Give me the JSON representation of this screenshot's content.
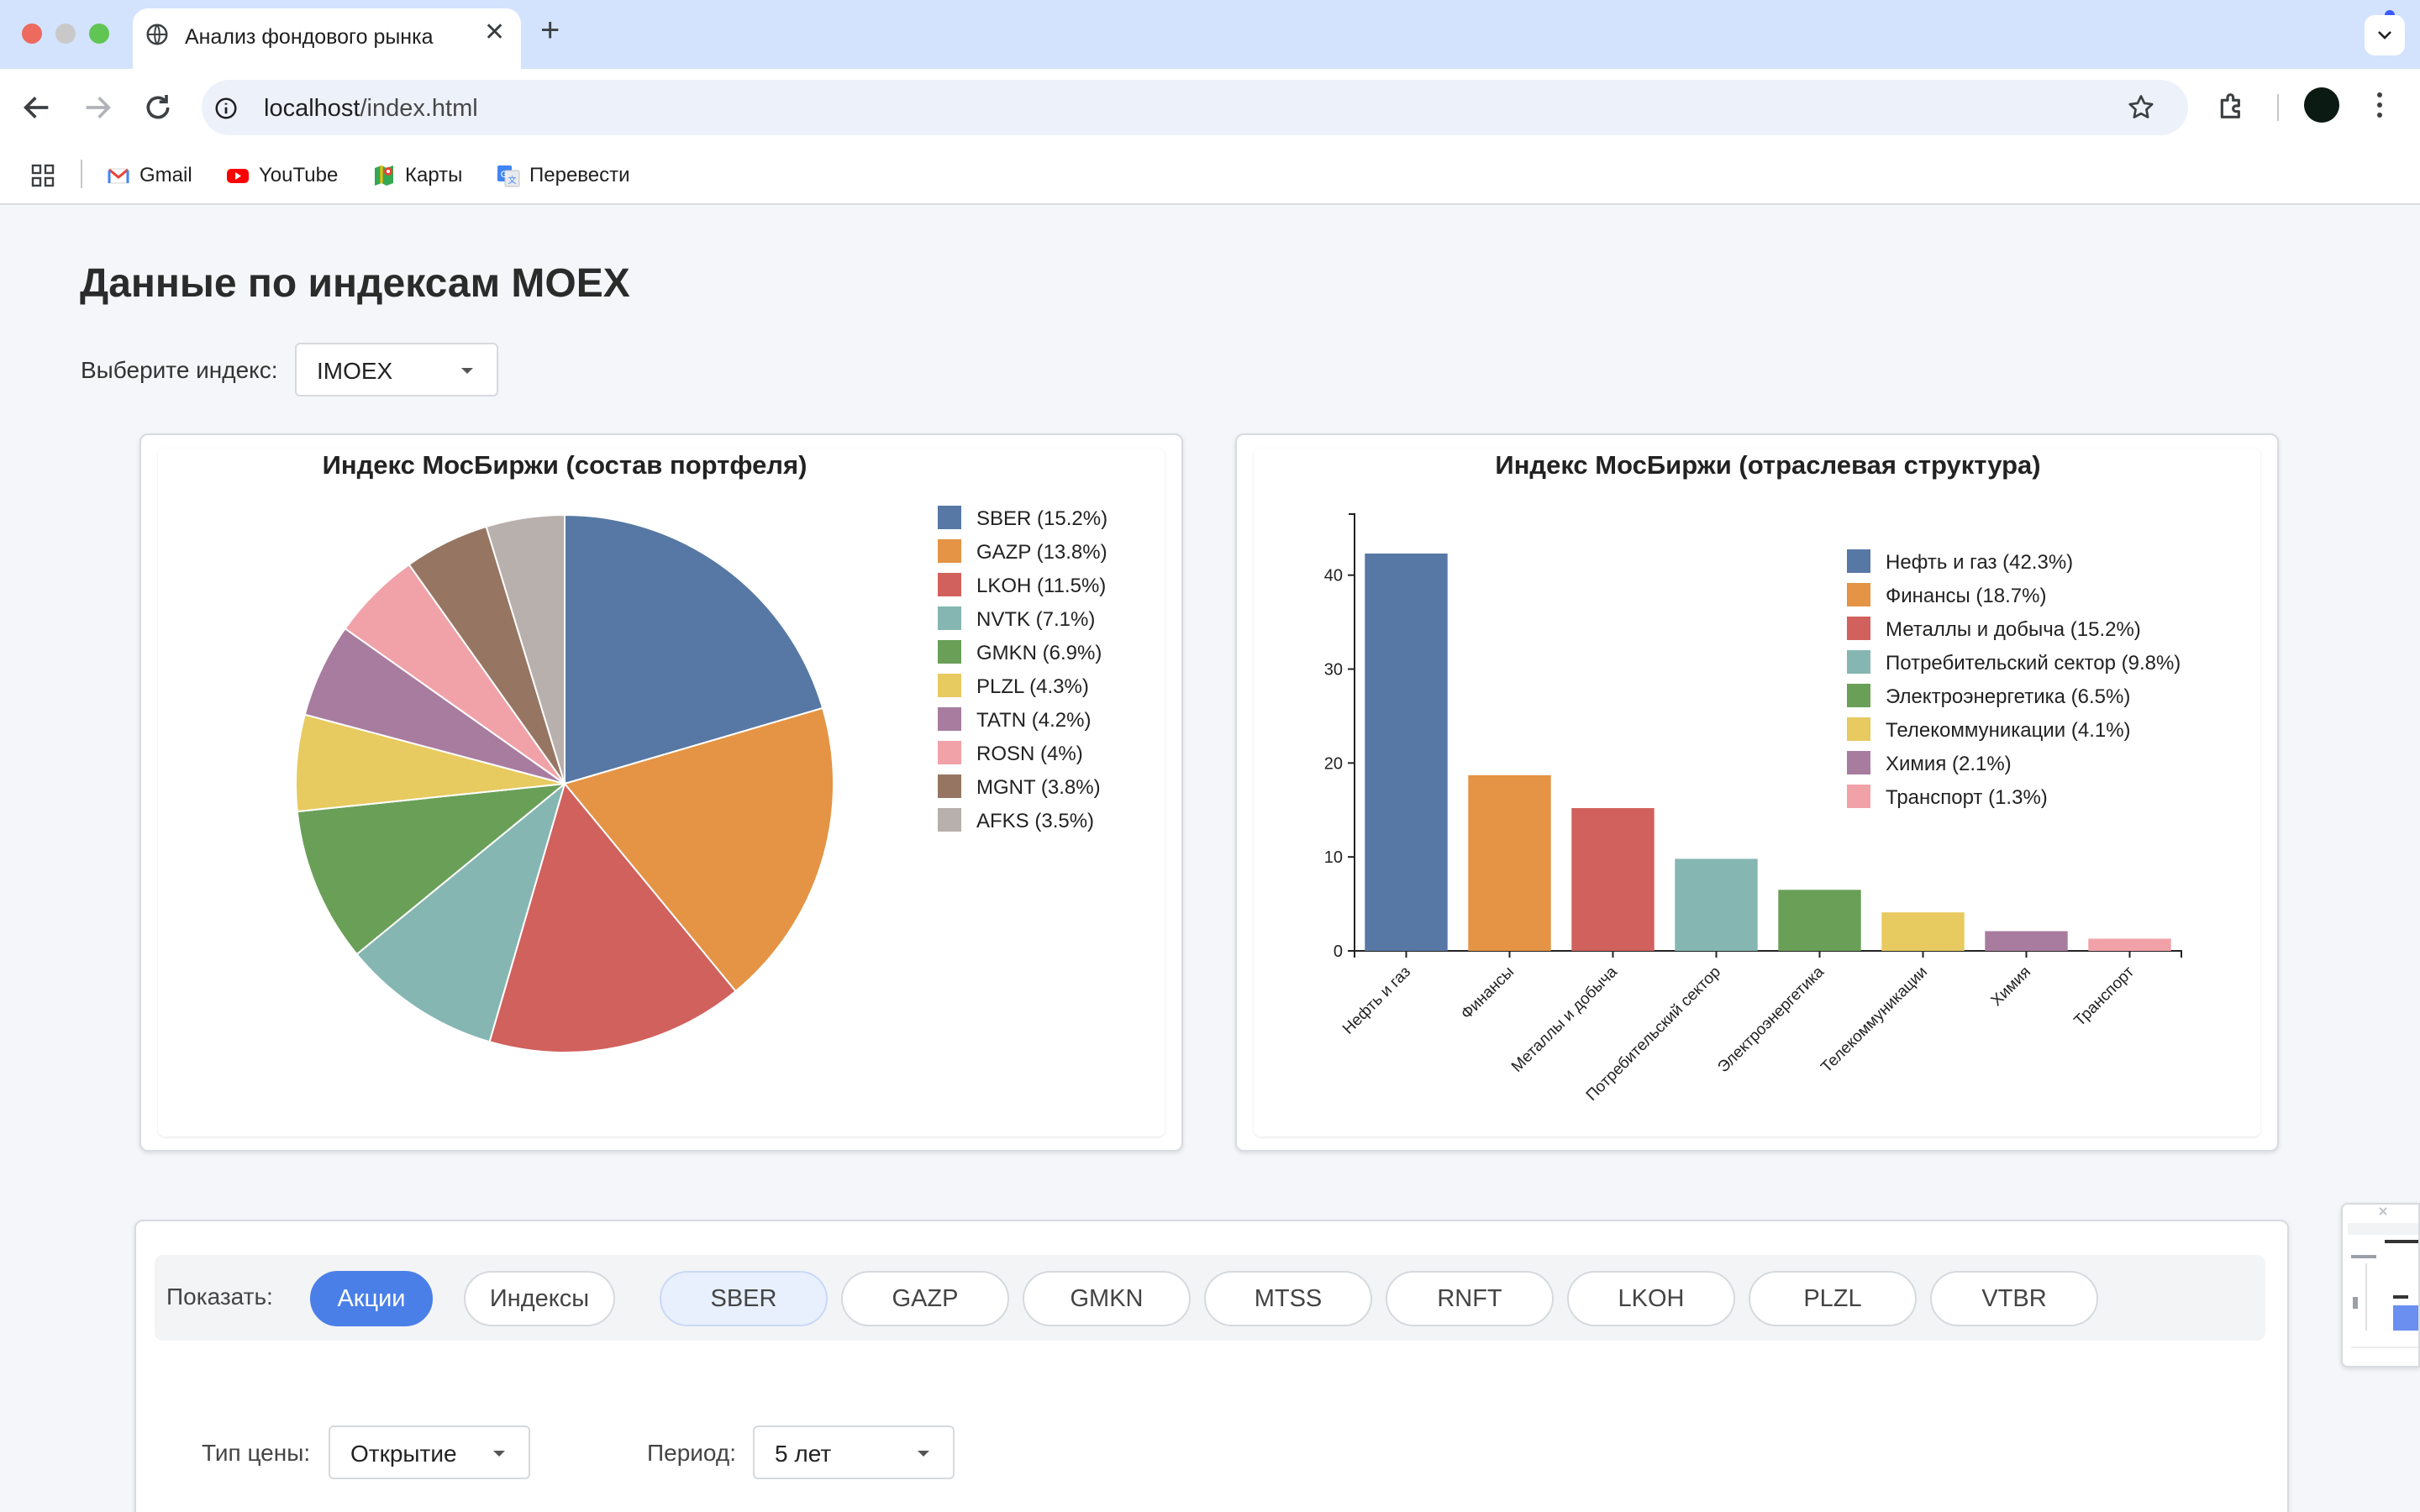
{
  "browser": {
    "tab_title": "Анализ фондового рынка",
    "url_host": "localhost",
    "url_path": "/index.html",
    "bookmarks": [
      {
        "label": "Gmail",
        "icon": "gmail-icon"
      },
      {
        "label": "YouTube",
        "icon": "youtube-icon"
      },
      {
        "label": "Карты",
        "icon": "maps-icon"
      },
      {
        "label": "Перевести",
        "icon": "translate-icon"
      }
    ]
  },
  "page": {
    "title": "Данные по индексам MOEX",
    "index_label": "Выберите индекс:",
    "index_value": "IMOEX"
  },
  "pie_chart": {
    "title": "Индекс МосБиржи (состав портфеля)"
  },
  "bar_chart": {
    "title": "Индекс МосБиржи (отраслевая структура)"
  },
  "chart_data": [
    {
      "type": "pie",
      "title": "Индекс МосБиржи (состав портфеля)",
      "legend_position": "right",
      "categories": [
        "SBER",
        "GAZP",
        "LKOH",
        "NVTK",
        "GMKN",
        "PLZL",
        "TATN",
        "ROSN",
        "MGNT",
        "AFKS"
      ],
      "values": [
        15.2,
        13.8,
        11.5,
        7.1,
        6.9,
        4.3,
        4.2,
        4,
        3.8,
        3.5
      ],
      "legend": [
        "SBER (15.2%)",
        "GAZP (13.8%)",
        "LKOH (11.5%)",
        "NVTK (7.1%)",
        "GMKN (6.9%)",
        "PLZL (4.3%)",
        "TATN (4.2%)",
        "ROSN (4%)",
        "MGNT (3.8%)",
        "AFKS (3.5%)"
      ],
      "colors": [
        "#5778a4",
        "#e49444",
        "#d1615d",
        "#85b6b2",
        "#6a9f58",
        "#e7ca60",
        "#a87c9f",
        "#f1a2a9",
        "#967662",
        "#b8b0ac"
      ]
    },
    {
      "type": "bar",
      "title": "Индекс МосБиржи (отраслевая структура)",
      "legend_position": "top-right",
      "categories": [
        "Нефть и газ",
        "Финансы",
        "Металлы и добыча",
        "Потребительский сектор",
        "Электроэнергетика",
        "Телекоммуникации",
        "Химия",
        "Транспорт"
      ],
      "values": [
        42.3,
        18.7,
        15.2,
        9.8,
        6.5,
        4.1,
        2.1,
        1.3
      ],
      "legend": [
        "Нефть и газ (42.3%)",
        "Финансы (18.7%)",
        "Металлы и добыча (15.2%)",
        "Потребительский сектор (9.8%)",
        "Электроэнергетика (6.5%)",
        "Телекоммуникации (4.1%)",
        "Химия (2.1%)",
        "Транспорт (1.3%)"
      ],
      "yticks": [
        0,
        10,
        20,
        30,
        40
      ],
      "ylim": [
        0,
        46.5
      ],
      "grid": false,
      "colors": [
        "#5778a4",
        "#e49444",
        "#d1615d",
        "#85b6b2",
        "#6a9f58",
        "#e7ca60",
        "#a87c9f",
        "#f1a2a9"
      ]
    }
  ],
  "filters": {
    "show_label": "Показать:",
    "type_buttons": [
      "Акции",
      "Индексы"
    ],
    "tickers": [
      "SBER",
      "GAZP",
      "GMKN",
      "MTSS",
      "RNFT",
      "LKOH",
      "PLZL",
      "VTBR"
    ],
    "price_label": "Тип цены:",
    "price_value": "Открытие",
    "period_label": "Период:",
    "period_value": "5 лет"
  }
}
